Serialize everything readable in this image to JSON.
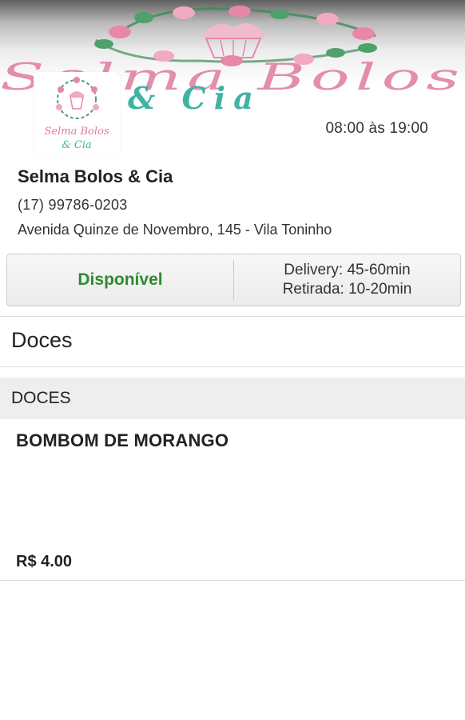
{
  "banner": {
    "script_text": "Selma Bolos",
    "script_text_2": "& Cia"
  },
  "logo": {
    "line1": "Selma Bolos",
    "line2": "& Cia"
  },
  "store": {
    "hours": "08:00 às 19:00",
    "name": "Selma Bolos & Cia",
    "phone": "(17) 99786-0203",
    "address": "Avenida Quinze de Novembro, 145 - Vila Toninho"
  },
  "status": {
    "availability": "Disponível",
    "delivery": "Delivery: 45-60min",
    "pickup": "Retirada: 10-20min"
  },
  "category": {
    "title": "Doces"
  },
  "section": {
    "title": "DOCES"
  },
  "products": [
    {
      "name": "BOMBOM DE MORANGO",
      "price": "R$ 4.00"
    }
  ],
  "colors": {
    "available_green": "#2e8b2e",
    "rose_pink": "#e07aa0",
    "mint": "#3fb3a4",
    "leaf_green": "#3f8a5a"
  }
}
